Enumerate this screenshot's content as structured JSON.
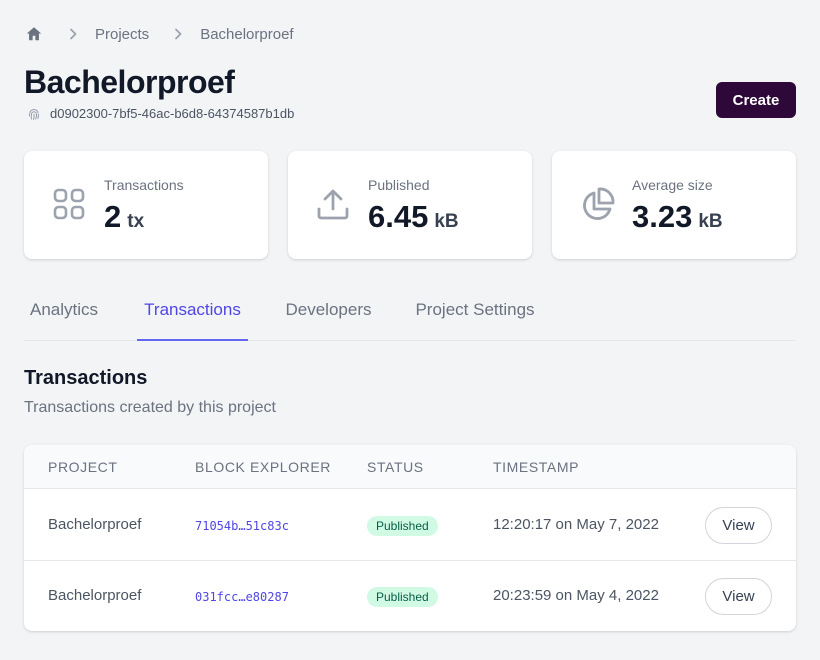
{
  "breadcrumb": {
    "home_icon": "home-icon",
    "separator_icon": "chevron-right-icon",
    "items": [
      "Projects",
      "Bachelorproef"
    ]
  },
  "project": {
    "title": "Bachelorproef",
    "id_icon": "fingerprint-icon",
    "id": "d0902300-7bf5-46ac-b6d8-64374587b1db"
  },
  "header": {
    "create_label": "Create",
    "create_color": "#2e0838"
  },
  "stats": [
    {
      "icon": "grid-icon",
      "label": "Transactions",
      "value": "2",
      "unit": "tx"
    },
    {
      "icon": "upload-icon",
      "label": "Published",
      "value": "6.45",
      "unit": "kB"
    },
    {
      "icon": "pie-chart-icon",
      "label": "Average size",
      "value": "3.23",
      "unit": "kB"
    }
  ],
  "tabs": [
    {
      "label": "Analytics",
      "active": false
    },
    {
      "label": "Transactions",
      "active": true
    },
    {
      "label": "Developers",
      "active": false
    },
    {
      "label": "Project Settings",
      "active": false
    }
  ],
  "section": {
    "title": "Transactions",
    "subtitle": "Transactions created by this project"
  },
  "table": {
    "columns": [
      "PROJECT",
      "BLOCK EXPLORER",
      "STATUS",
      "TIMESTAMP"
    ],
    "rows": [
      {
        "project": "Bachelorproef",
        "hash": "71054b…51c83c",
        "status": "Published",
        "timestamp": "12:20:17 on May 7, 2022",
        "action": "View"
      },
      {
        "project": "Bachelorproef",
        "hash": "031fcc…e80287",
        "status": "Published",
        "timestamp": "20:23:59 on May 4, 2022",
        "action": "View"
      }
    ]
  },
  "colors": {
    "accent": "#4f46e5",
    "badge_bg": "#d1fae5",
    "badge_text": "#065f46"
  }
}
